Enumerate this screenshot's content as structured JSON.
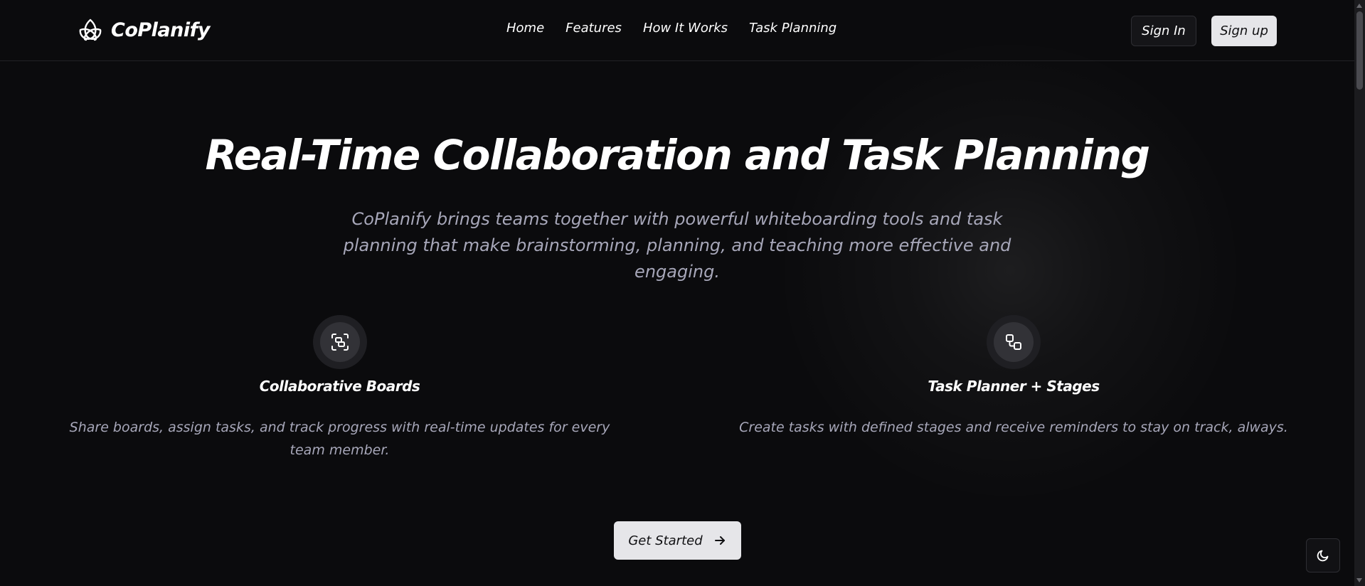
{
  "navbar": {
    "brand_name": "CoPlanify",
    "brand_icon": "triquetra-logo-icon",
    "links": [
      "Home",
      "Features",
      "How It Works",
      "Task Planning"
    ],
    "sign_in_label": "Sign In",
    "sign_up_label": "Sign up"
  },
  "hero": {
    "title": "Real-Time Collaboration and Task Planning",
    "subtitle": "CoPlanify brings teams together with powerful whiteboarding tools and task planning that make brainstorming, planning, and teaching more effective and engaging."
  },
  "features": [
    {
      "icon": "scan-frame-icon",
      "title": "Collaborative Boards",
      "description": "Share boards, assign tasks, and track progress with real-time updates for every team member."
    },
    {
      "icon": "linked-squares-icon",
      "title": "Task Planner + Stages",
      "description": "Create tasks with defined stages and receive reminders to stay on track, always."
    }
  ],
  "cta": {
    "label": "Get Started",
    "icon": "arrow-right-icon"
  },
  "theme_toggle": {
    "icon": "moon-icon"
  },
  "colors": {
    "background": "#0b0b0d",
    "text_primary": "#ffffff",
    "text_muted": "#a7a7b9",
    "button_light": "#e6e6e9",
    "button_dark": "#151518",
    "border": "#2e2e33"
  }
}
